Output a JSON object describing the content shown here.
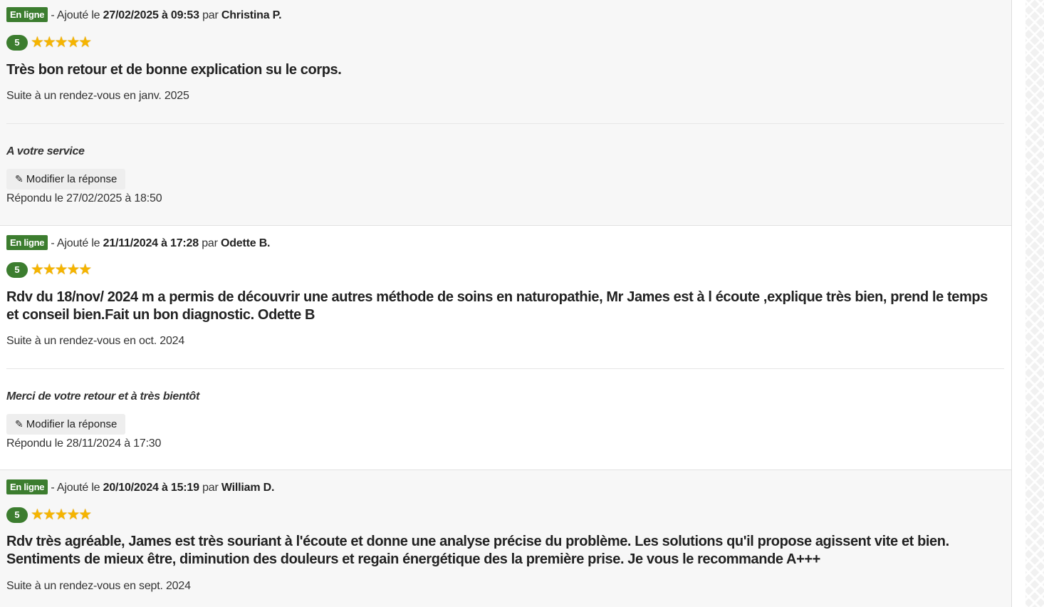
{
  "reviews": [
    {
      "status": "En ligne",
      "added_prefix": "- Ajouté le",
      "date": "27/02/2025 à 09:53",
      "by": "par",
      "author": "Christina P.",
      "rating": "5",
      "rating_value": 5,
      "stars": "★★★★★",
      "title": "Très bon retour et de bonne explication su le corps.",
      "visit": "Suite à un rendez-vous en janv. 2025",
      "reply": "A votre service",
      "edit_label": "Modifier la réponse",
      "replied": "Répondu le 27/02/2025 à 18:50"
    },
    {
      "status": "En ligne",
      "added_prefix": "- Ajouté le",
      "date": "21/11/2024 à 17:28",
      "by": "par",
      "author": "Odette B.",
      "rating": "5",
      "rating_value": 5,
      "stars": "★★★★★",
      "title": "Rdv du 18/nov/ 2024 m a permis de découvrir une autres méthode de soins en naturopathie, Mr James est à l écoute ,explique très bien, prend le temps et conseil bien.Fait un bon diagnostic. Odette B",
      "visit": "Suite à un rendez-vous en oct. 2024",
      "reply": "Merci de votre retour et à très bientôt",
      "edit_label": "Modifier la réponse",
      "replied": "Répondu le 28/11/2024 à 17:30"
    },
    {
      "status": "En ligne",
      "added_prefix": "- Ajouté le",
      "date": "20/10/2024 à 15:19",
      "by": "par",
      "author": "William D.",
      "rating": "5",
      "rating_value": 5,
      "stars": "★★★★★",
      "title": "Rdv très agréable, James est très souriant à l'écoute et donne une analyse précise du problème. Les solutions qu'il propose agissent vite et bien. Sentiments de mieux être, diminution des douleurs et regain énergétique des la première prise. Je vous le recommande A+++",
      "visit": "Suite à un rendez-vous en sept. 2024"
    }
  ],
  "icons": {
    "edit": "edit-icon",
    "star": "star-icon"
  },
  "colors": {
    "badge_green": "#3c7d2f",
    "star_gold": "#f5b400"
  }
}
